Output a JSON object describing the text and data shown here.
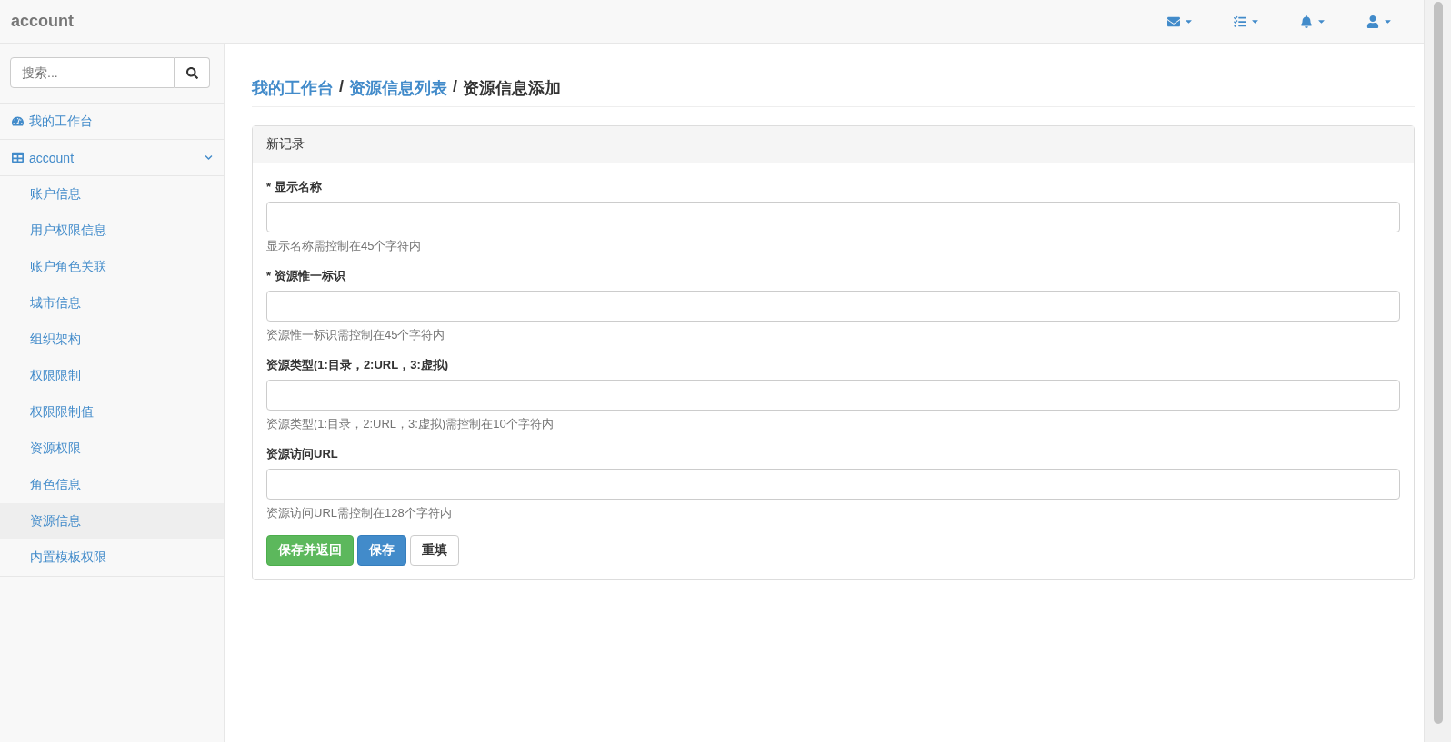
{
  "navbar": {
    "brand": "account",
    "icons": [
      {
        "kind": "mail"
      },
      {
        "kind": "tasks"
      },
      {
        "kind": "bell"
      },
      {
        "kind": "user"
      }
    ]
  },
  "sidebar": {
    "search": {
      "placeholder": "搜索..."
    },
    "items": [
      {
        "label": "我的工作台"
      },
      {
        "label": "account",
        "expanded": true,
        "children": [
          {
            "label": "账户信息",
            "selected": false
          },
          {
            "label": "用户权限信息",
            "selected": false
          },
          {
            "label": "账户角色关联",
            "selected": false
          },
          {
            "label": "城市信息",
            "selected": false
          },
          {
            "label": "组织架构",
            "selected": false
          },
          {
            "label": "权限限制",
            "selected": false
          },
          {
            "label": "权限限制值",
            "selected": false
          },
          {
            "label": "资源权限",
            "selected": false
          },
          {
            "label": "角色信息",
            "selected": false
          },
          {
            "label": "资源信息",
            "selected": true
          },
          {
            "label": "内置模板权限",
            "selected": false
          }
        ]
      }
    ]
  },
  "breadcrumb": [
    {
      "label": "我的工作台",
      "kind": "link"
    },
    {
      "label": "/",
      "kind": "separator"
    },
    {
      "label": "资源信息列表",
      "kind": "link"
    },
    {
      "label": "/",
      "kind": "separator"
    },
    {
      "label": "资源信息添加",
      "kind": "current"
    }
  ],
  "panel": {
    "title": "新记录",
    "fields": [
      {
        "label": "* 显示名称",
        "help": "显示名称需控制在45个字符内"
      },
      {
        "label": "* 资源惟一标识",
        "help": "资源惟一标识需控制在45个字符内"
      },
      {
        "label": "资源类型(1:目录，2:URL，3:虚拟)",
        "help": "资源类型(1:目录，2:URL，3:虚拟)需控制在10个字符内"
      },
      {
        "label": "资源访问URL",
        "help": "资源访问URL需控制在128个字符内"
      }
    ],
    "buttons": [
      {
        "label": "保存并返回",
        "kind": "success"
      },
      {
        "label": "保存",
        "kind": "primary"
      },
      {
        "label": "重填",
        "kind": "default"
      }
    ]
  }
}
